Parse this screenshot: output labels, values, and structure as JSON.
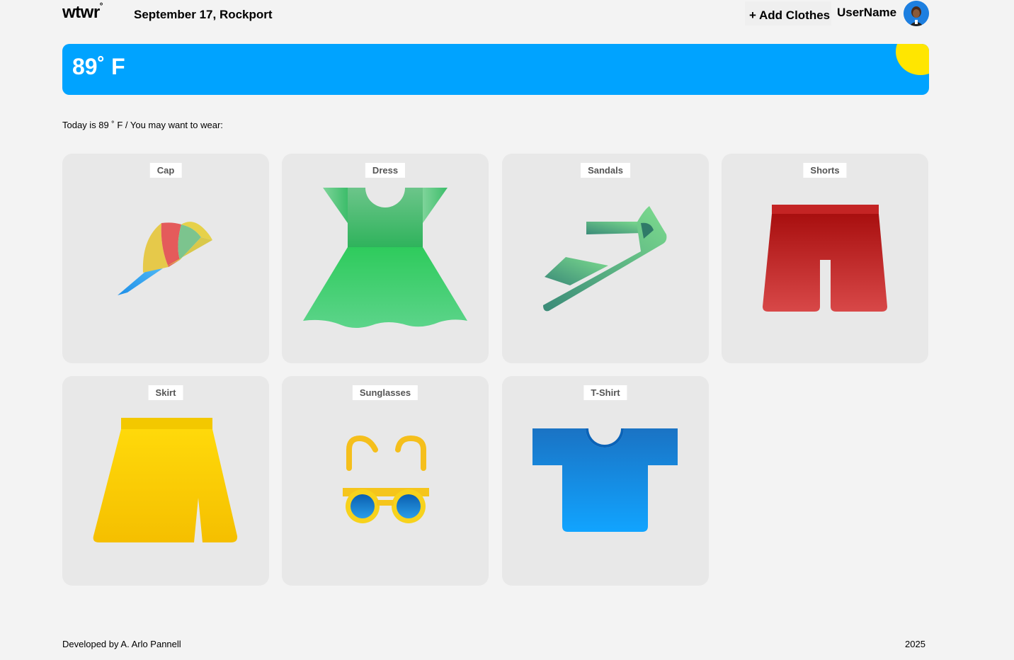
{
  "header": {
    "logo": "wtwr",
    "logo_mark": "°",
    "date_location": "September 17, Rockport",
    "add_clothes": "+ Add Clothes",
    "username": "UserName"
  },
  "weather": {
    "temperature": "89˚ F",
    "condition_icon": "sun-icon",
    "banner_color": "#00a3ff",
    "sun_color": "#ffe600"
  },
  "advice": "Today is 89 ˚ F / You may want to wear:",
  "items": [
    {
      "label": "Cap",
      "icon": "cap-icon"
    },
    {
      "label": "Dress",
      "icon": "dress-icon"
    },
    {
      "label": "Sandals",
      "icon": "sandals-icon"
    },
    {
      "label": "Shorts",
      "icon": "shorts-icon"
    },
    {
      "label": "Skirt",
      "icon": "skirt-icon"
    },
    {
      "label": "Sunglasses",
      "icon": "sunglasses-icon"
    },
    {
      "label": "T-Shirt",
      "icon": "tshirt-icon"
    }
  ],
  "footer": {
    "developer": "Developed by A. Arlo Pannell",
    "year": "2025"
  }
}
